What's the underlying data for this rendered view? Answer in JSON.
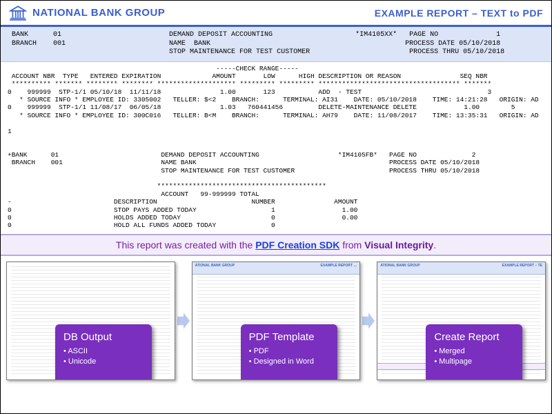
{
  "brand": {
    "name": "NATIONAL BANK GROUP",
    "report_title": "EXAMPLE REPORT – TEXT to PDF"
  },
  "header": {
    "text": " BANK      01                          DEMAND DEPOSIT ACCOUNTING                    *IM4105XX*   PAGE NO              1\n BRANCH    001                         NAME  BANK                                               PROCESS DATE 05/10/2018\n                                       STOP MAINTENANCE FOR TEST CUSTOMER                        PROCESS THRU 05/10/2018"
  },
  "body": {
    "text": "                                                     -----CHECK RANGE-----\n ACCOUNT NBR  TYPE   ENTERED EXPIRATION             AMOUNT       LOW      HIGH DESCRIPTION OR REASON               SEQ NBR\n ********** ******* ******** ******** ******************** ********* ********* ************************************ *******\n0    999999  STP-1/1 05/10/18  11/11/18               1.00       123           ADD  - TEST                                3\n   * SOURCE INFO * EMPLOYEE ID: 3305002   TELLER: $<2    BRANCH:      TERMINAL: AI31    DATE: 05/10/2018    TIME: 14:21:28   ORIGIN: AD\n0    999999  STP-1/1 11/08/17  06/05/18               1.03   760441456         DELETE-MAINTENANCE DELETE            1.00        5\n   * SOURCE INFO * EMPLOYEE ID: 300C016   TELLER: B<M    BRANCH:      TERMINAL: AH79    DATE: 11/08/2017    TIME: 13:35:31   ORIGIN: AD\n\n1\n\n\n+BANK      01                          DEMAND DEPOSIT ACCOUNTING                    *IM4105FB*   PAGE NO              2\n BRANCH    001                         NAME BANK                                                 PROCESS DATE 05/10/2018\n                                       STOP MAINTENANCE FOR TEST CUSTOMER                        PROCESS THRU 05/10/2018\n\n                                      *******************************************\n                                       ACCOUNT   99-999999 TOTAL\n-                          DESCRIPTION                        NUMBER               AMOUNT\n0                          STOP PAYS ADDED TODAY                   1                 1.00\n0                          HOLDS ADDED TODAY                       0                 0.00\n0                          HOLD ALL FUNDS ADDED TODAY              0"
  },
  "credit": {
    "prefix": "This report was created with the ",
    "link": "PDF Creation SDK",
    "mid": " from ",
    "visint": "Visual Integrity",
    "suffix": "."
  },
  "workflow": {
    "stages": [
      {
        "title": "DB Output",
        "bullets": [
          "ASCII",
          "Unicode"
        ],
        "showHeader": false,
        "showFooter": false,
        "thumbLeft": "",
        "thumbRight": ""
      },
      {
        "title": "PDF Template",
        "bullets": [
          "PDF",
          "Designed in Word"
        ],
        "showHeader": true,
        "showFooter": false,
        "thumbLeft": "ATIONAL BANK GROUP",
        "thumbRight": "EXAMPLE REPORT …"
      },
      {
        "title": "Create Report",
        "bullets": [
          "Merged",
          "Multipage"
        ],
        "showHeader": true,
        "showFooter": true,
        "thumbLeft": "ATIONAL BANK GROUP",
        "thumbRight": "EXAMPLE REPORT – TE"
      }
    ]
  }
}
